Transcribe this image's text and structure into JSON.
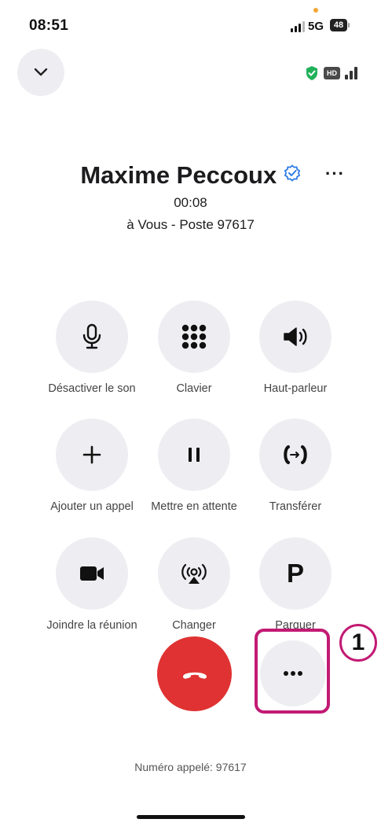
{
  "status_bar": {
    "time": "08:51",
    "network": "5G",
    "battery": "48"
  },
  "call": {
    "caller_name": "Maxime Peccoux",
    "duration": "00:08",
    "destination": "à Vous - Poste 97617",
    "quality_badge": "HD",
    "more_label": "···"
  },
  "controls": [
    {
      "label": "Désactiver le son",
      "icon": "microphone-icon"
    },
    {
      "label": "Clavier",
      "icon": "keypad-icon"
    },
    {
      "label": "Haut-parleur",
      "icon": "speaker-icon"
    },
    {
      "label": "Ajouter un appel",
      "icon": "plus-icon"
    },
    {
      "label": "Mettre en attente",
      "icon": "pause-icon"
    },
    {
      "label": "Transférer",
      "icon": "transfer-icon"
    },
    {
      "label": "Joindre la réunion",
      "icon": "video-camera-icon"
    },
    {
      "label": "Changer",
      "icon": "switch-device-icon"
    },
    {
      "label": "Parquer",
      "icon": "park-icon",
      "glyph": "P"
    }
  ],
  "annotation": {
    "step": "1"
  },
  "footer": {
    "dialed": "Numéro appelé: 97617"
  },
  "colors": {
    "end_call": "#e03232",
    "annotation": "#c21a73",
    "button_bg": "#eeeef2",
    "verified": "#2f7be6",
    "shield": "#20b15a"
  }
}
